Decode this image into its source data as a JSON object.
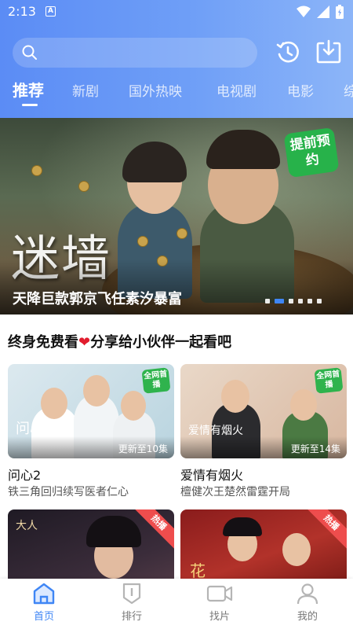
{
  "status": {
    "time": "2:13",
    "a_icon": "A"
  },
  "header": {
    "search_placeholder": "",
    "tabs": [
      {
        "label": "推荐",
        "active": true
      },
      {
        "label": "新剧",
        "active": false
      },
      {
        "label": "国外热映",
        "active": false
      },
      {
        "label": "电视剧",
        "active": false
      },
      {
        "label": "电影",
        "active": false
      },
      {
        "label": "综",
        "active": false
      }
    ]
  },
  "banner": {
    "title_art": "迷墙",
    "badge": "提前预约",
    "caption": "天降巨款郭京飞任素汐暴富",
    "dots_total": 6,
    "dot_active": 1
  },
  "section": {
    "title_prefix": "终身免费看",
    "heart": "❤",
    "title_suffix": "分享给小伙伴一起看吧"
  },
  "cards": [
    {
      "title": "问心2",
      "subtitle": "铁三角回归续写医者仁心",
      "update": "更新至10集",
      "badge": "全网首播",
      "thumb_text": "问心2"
    },
    {
      "title": "爱情有烟火",
      "subtitle": "檀健次王楚然雷霆开局",
      "update": "更新至14集",
      "badge": "全网首播",
      "thumb_text": "爱情有烟火"
    },
    {
      "title": "",
      "subtitle": "",
      "update": "",
      "ribbon": "热播",
      "thumb_text": "大人"
    },
    {
      "title": "",
      "subtitle": "",
      "update": "",
      "ribbon": "热播",
      "thumb_text": "花"
    }
  ],
  "bottom_nav": [
    {
      "label": "首页",
      "icon": "home-icon",
      "active": true
    },
    {
      "label": "排行",
      "icon": "ranking-icon",
      "active": false
    },
    {
      "label": "找片",
      "icon": "video-camera-icon",
      "active": false
    },
    {
      "label": "我的",
      "icon": "user-icon",
      "active": false
    }
  ],
  "colors": {
    "accent": "#3f86f5",
    "header_start": "#5b8cf5",
    "header_end": "#8cb5f8",
    "hot": "#ee4d4d",
    "badge_green": "#27b24a"
  }
}
